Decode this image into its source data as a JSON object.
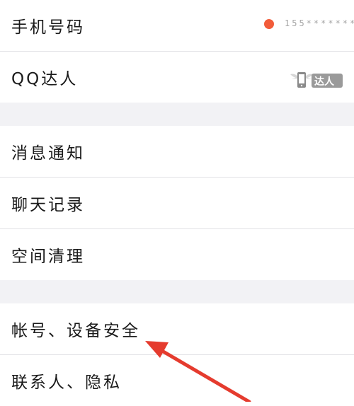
{
  "settings": {
    "items": [
      {
        "label": "手机号码",
        "value": "155*******"
      },
      {
        "label": "QQ达人",
        "badge": "达人"
      },
      {
        "label": "消息通知"
      },
      {
        "label": "聊天记录"
      },
      {
        "label": "空间清理"
      },
      {
        "label": "帐号、设备安全"
      },
      {
        "label": "联系人、隐私"
      }
    ]
  },
  "colors": {
    "accent_dot": "#f25c3a",
    "arrow": "#e53b2e",
    "row_background": "#ffffff",
    "group_gap": "#f2f2f5"
  },
  "icons": [
    "red-dot-indicator",
    "qq-daren-badge-icon",
    "annotation-arrow"
  ]
}
